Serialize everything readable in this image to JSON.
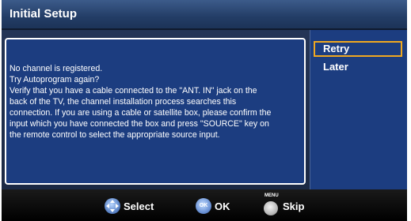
{
  "window": {
    "title": "Initial Setup"
  },
  "message": {
    "lines": [
      "No channel is registered.",
      "Try Autoprogram again?",
      "Verify that you have a cable connected to the \"ANT. IN\" jack on the",
      "back of the TV, the channel installation process searches this",
      "connection. If you are using a cable or satellite box, please confirm the",
      "input which you have connected the box and press \"SOURCE\" key on",
      "the remote control to select the appropriate source input."
    ]
  },
  "options": [
    {
      "label": "Retry",
      "selected": true
    },
    {
      "label": "Later",
      "selected": false
    }
  ],
  "footer": {
    "select": {
      "icon": "navigation-pad-icon",
      "label": "Select"
    },
    "ok": {
      "icon": "ok-button-icon",
      "icon_text": "OK",
      "label": "OK"
    },
    "skip": {
      "icon": "menu-button-icon",
      "icon_text": "MENU",
      "label": "Skip"
    }
  },
  "colors": {
    "accent_selected": "#f0a820",
    "panel_blue": "#1c3d80",
    "titlebar": "#2a4672"
  }
}
